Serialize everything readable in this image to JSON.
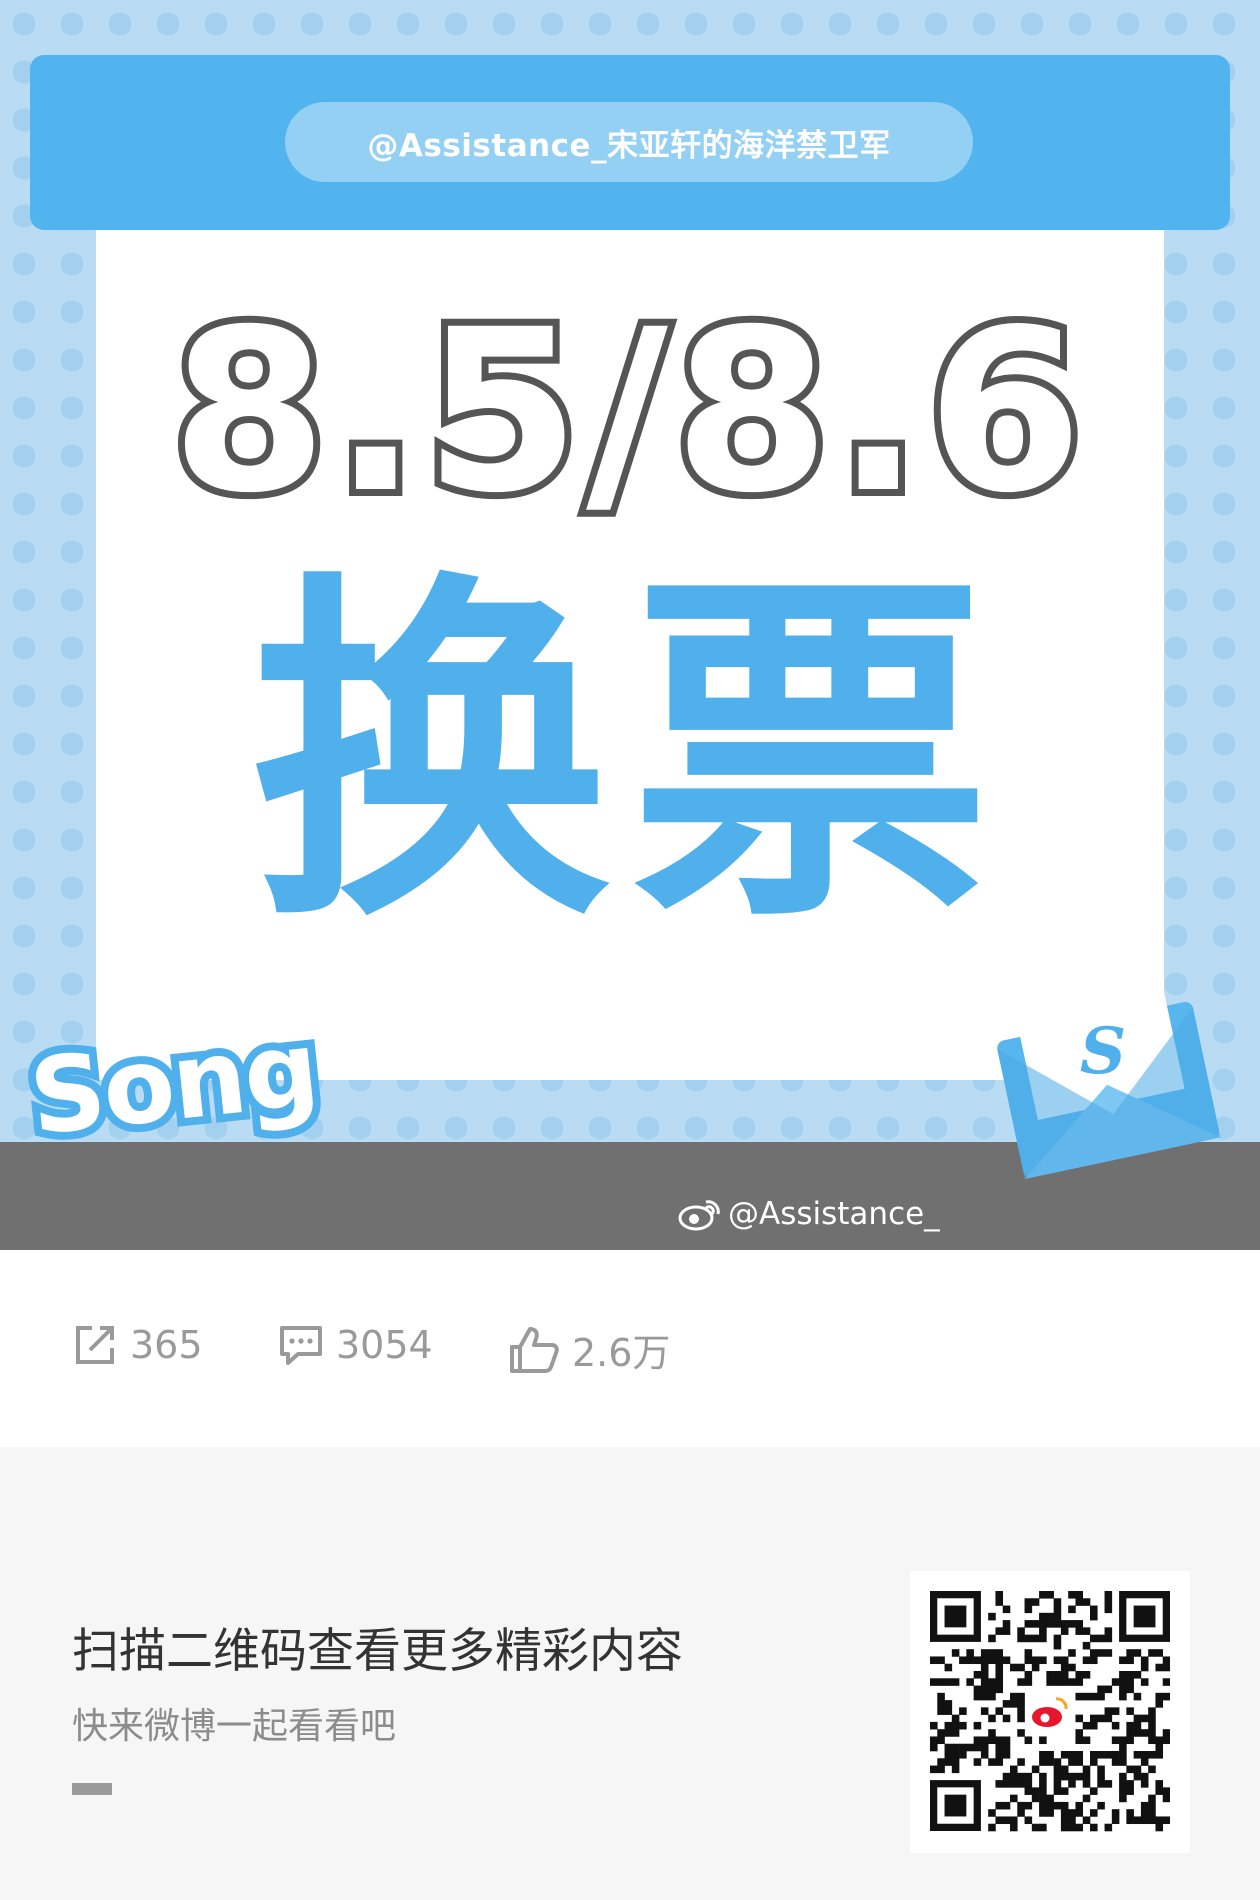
{
  "poster": {
    "handle_banner": "@Assistance_宋亚轩的海洋禁卫军",
    "date": "8.5/8.6",
    "headline": "换票",
    "logo_text": "Song",
    "envelope_letter": "S",
    "watermark": "@Assistance_"
  },
  "stats": {
    "reposts": "365",
    "comments": "3054",
    "likes": "2.6万"
  },
  "footer": {
    "title": "扫描二维码查看更多精彩内容",
    "subtitle": "快来微博一起看看吧"
  },
  "colors": {
    "accent_blue": "#4fb0ec",
    "banner_blue": "#52b4ee",
    "text_gray": "#9a9a9a"
  },
  "icons": [
    "repost-icon",
    "comment-icon",
    "like-icon",
    "weibo-logo-icon",
    "qr-code-icon"
  ]
}
